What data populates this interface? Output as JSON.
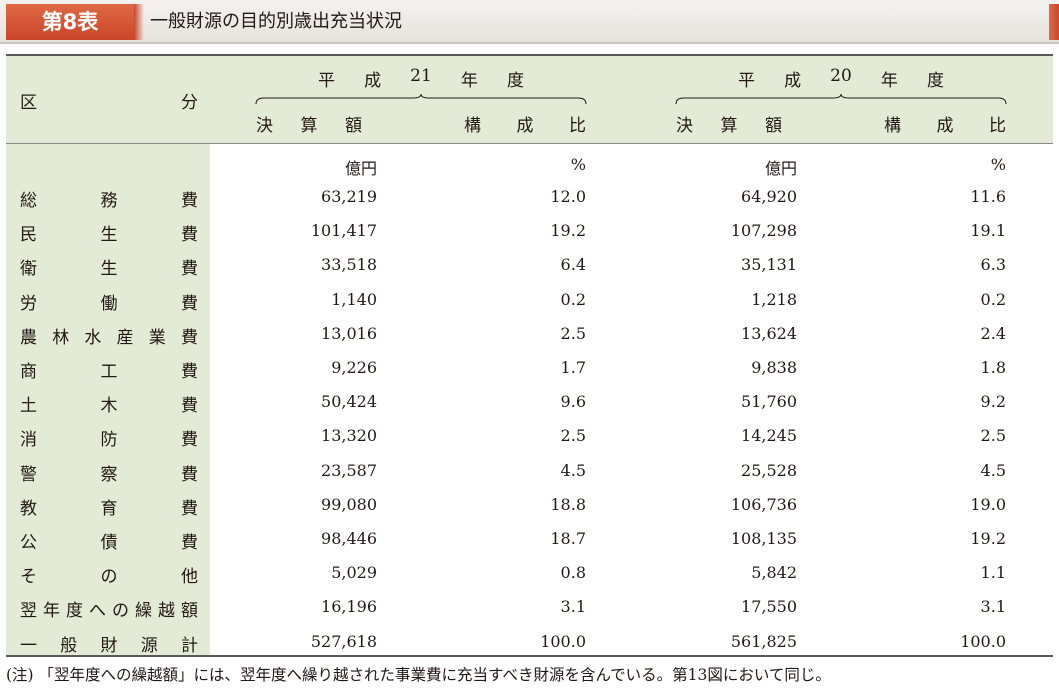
{
  "title": {
    "badge": "第8表",
    "text": "一般財源の目的別歳出充当状況"
  },
  "header": {
    "row_label": "区分",
    "fy21": "平成21年度",
    "fy20": "平成20年度",
    "col_amount": "決算額",
    "col_ratio": "構成比",
    "unit_amount": "億円",
    "unit_ratio": "%"
  },
  "rows": [
    {
      "label": "総務費",
      "fy21_amount": "63,219",
      "fy21_ratio": "12.0",
      "fy20_amount": "64,920",
      "fy20_ratio": "11.6"
    },
    {
      "label": "民生費",
      "fy21_amount": "101,417",
      "fy21_ratio": "19.2",
      "fy20_amount": "107,298",
      "fy20_ratio": "19.1"
    },
    {
      "label": "衛生費",
      "fy21_amount": "33,518",
      "fy21_ratio": "6.4",
      "fy20_amount": "35,131",
      "fy20_ratio": "6.3"
    },
    {
      "label": "労働費",
      "fy21_amount": "1,140",
      "fy21_ratio": "0.2",
      "fy20_amount": "1,218",
      "fy20_ratio": "0.2"
    },
    {
      "label": "農林水産業費",
      "fy21_amount": "13,016",
      "fy21_ratio": "2.5",
      "fy20_amount": "13,624",
      "fy20_ratio": "2.4"
    },
    {
      "label": "商工費",
      "fy21_amount": "9,226",
      "fy21_ratio": "1.7",
      "fy20_amount": "9,838",
      "fy20_ratio": "1.8"
    },
    {
      "label": "土木費",
      "fy21_amount": "50,424",
      "fy21_ratio": "9.6",
      "fy20_amount": "51,760",
      "fy20_ratio": "9.2"
    },
    {
      "label": "消防費",
      "fy21_amount": "13,320",
      "fy21_ratio": "2.5",
      "fy20_amount": "14,245",
      "fy20_ratio": "2.5"
    },
    {
      "label": "警察費",
      "fy21_amount": "23,587",
      "fy21_ratio": "4.5",
      "fy20_amount": "25,528",
      "fy20_ratio": "4.5"
    },
    {
      "label": "教育費",
      "fy21_amount": "99,080",
      "fy21_ratio": "18.8",
      "fy20_amount": "106,736",
      "fy20_ratio": "19.0"
    },
    {
      "label": "公債費",
      "fy21_amount": "98,446",
      "fy21_ratio": "18.7",
      "fy20_amount": "108,135",
      "fy20_ratio": "19.2"
    },
    {
      "label": "その他",
      "fy21_amount": "5,029",
      "fy21_ratio": "0.8",
      "fy20_amount": "5,842",
      "fy20_ratio": "1.1"
    },
    {
      "label": "翌年度への繰越額",
      "fy21_amount": "16,196",
      "fy21_ratio": "3.1",
      "fy20_amount": "17,550",
      "fy20_ratio": "3.1"
    },
    {
      "label": "一般財源計",
      "fy21_amount": "527,618",
      "fy21_ratio": "100.0",
      "fy20_amount": "561,825",
      "fy20_ratio": "100.0"
    }
  ],
  "note": "(注) 「翌年度への繰越額」には、翌年度へ繰り越された事業費に充当すべき財源を含んでいる。第13図において同じ。"
}
